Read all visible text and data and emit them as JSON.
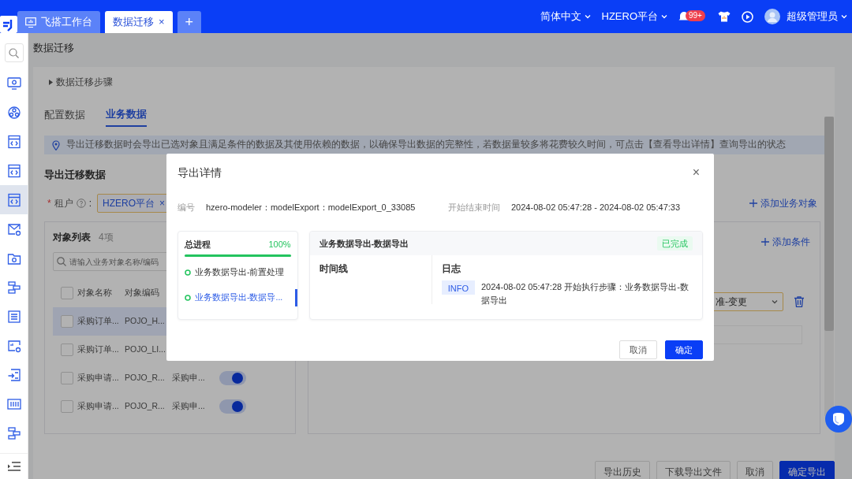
{
  "header": {
    "tabs": [
      {
        "label": "飞搭工作台",
        "kind": "home",
        "selected": false
      },
      {
        "label": "数据迁移",
        "close": "×",
        "kind": "page",
        "selected": true
      }
    ],
    "add_tab": "+",
    "language": "简体中文",
    "tenant": "HZERO平台",
    "notification_count": "99+",
    "user": "超级管理员"
  },
  "sidebar": {
    "items": [
      {
        "kind": "monitor",
        "selected": false
      },
      {
        "kind": "network",
        "selected": false
      },
      {
        "kind": "code",
        "selected": false
      },
      {
        "kind": "code",
        "selected": false
      },
      {
        "kind": "code",
        "selected": true
      },
      {
        "kind": "mail",
        "selected": false
      },
      {
        "kind": "folder",
        "selected": false
      },
      {
        "kind": "diagram",
        "selected": false
      },
      {
        "kind": "list",
        "selected": false
      },
      {
        "kind": "chart",
        "selected": false
      },
      {
        "kind": "import",
        "selected": false
      },
      {
        "kind": "sliders",
        "selected": false
      },
      {
        "kind": "diagram",
        "selected": false
      }
    ]
  },
  "page": {
    "title": "数据迁移",
    "steps_toggle": "数据迁移步骤",
    "tabs": [
      {
        "label": "配置数据",
        "selected": false
      },
      {
        "label": "业务数据",
        "selected": true
      }
    ],
    "alert": "导出迁移数据时会导出已选对象且满足条件的数据及其使用依赖的数据，以确保导出数据的完整性，若数据量较多将花费较久时间，可点击【查看导出详情】查询导出的状态",
    "section_title": "导出迁移数据",
    "tenant": {
      "mark": "*",
      "label": "租户",
      "colon": ":",
      "tag": "HZERO平台",
      "tag_close": "×"
    },
    "add_object": "添加业务对象",
    "object_list": {
      "title": "对象列表",
      "count": "4项",
      "search_placeholder": "请输入业务对象名称/编码",
      "select_all_checked": false,
      "columns": [
        "对象名称",
        "对象编码"
      ],
      "rows": [
        {
          "cells": [
            "采购订单...",
            "POJO_H..."
          ],
          "checked": false,
          "selected": true
        },
        {
          "cells": [
            "采购订单...",
            "POJO_LI..."
          ],
          "checked": false,
          "selected": false
        },
        {
          "cells": [
            "采购申请...",
            "POJO_R...",
            "采购申..."
          ],
          "checked": false,
          "selected": false,
          "on": true
        },
        {
          "cells": [
            "采购申请...",
            "POJO_R...",
            "采购申..."
          ],
          "checked": false,
          "selected": false,
          "on": true
        }
      ]
    },
    "conditions": {
      "add": "添加条件",
      "select_value": "准-变更"
    },
    "footer_buttons": [
      {
        "label": "导出历史",
        "kind": "default"
      },
      {
        "label": "下载导出文件",
        "kind": "default"
      },
      {
        "label": "取消",
        "kind": "default"
      },
      {
        "label": "确定导出",
        "kind": "primary"
      }
    ]
  },
  "modal": {
    "title": "导出详情",
    "close": "×",
    "code_label": "编号",
    "code": "hzero-modeler：modelExport：modelExport_0_33085",
    "time_label": "开始结束时间",
    "time": "2024-08-02 05:47:28 - 2024-08-02 05:47:33",
    "overall": {
      "label": "总进程",
      "percent": "100%",
      "level": 1
    },
    "steps": [
      {
        "label": "业务数据导出-前置处理",
        "selected": false
      },
      {
        "label": "业务数据导出-数据导...",
        "selected": true
      }
    ],
    "detail": {
      "title": "业务数据导出-数据导出",
      "status": {
        "label": "已完成",
        "kind": "success"
      },
      "timeline_title": "时间线",
      "log_title": "日志",
      "logs": [
        {
          "level": "INFO",
          "text": "2024-08-02  05:47:28  开始执行步骤：业务数据导出-数据导出"
        }
      ]
    },
    "buttons": [
      {
        "label": "取消",
        "kind": "default"
      },
      {
        "label": "确定",
        "kind": "primary"
      }
    ]
  }
}
